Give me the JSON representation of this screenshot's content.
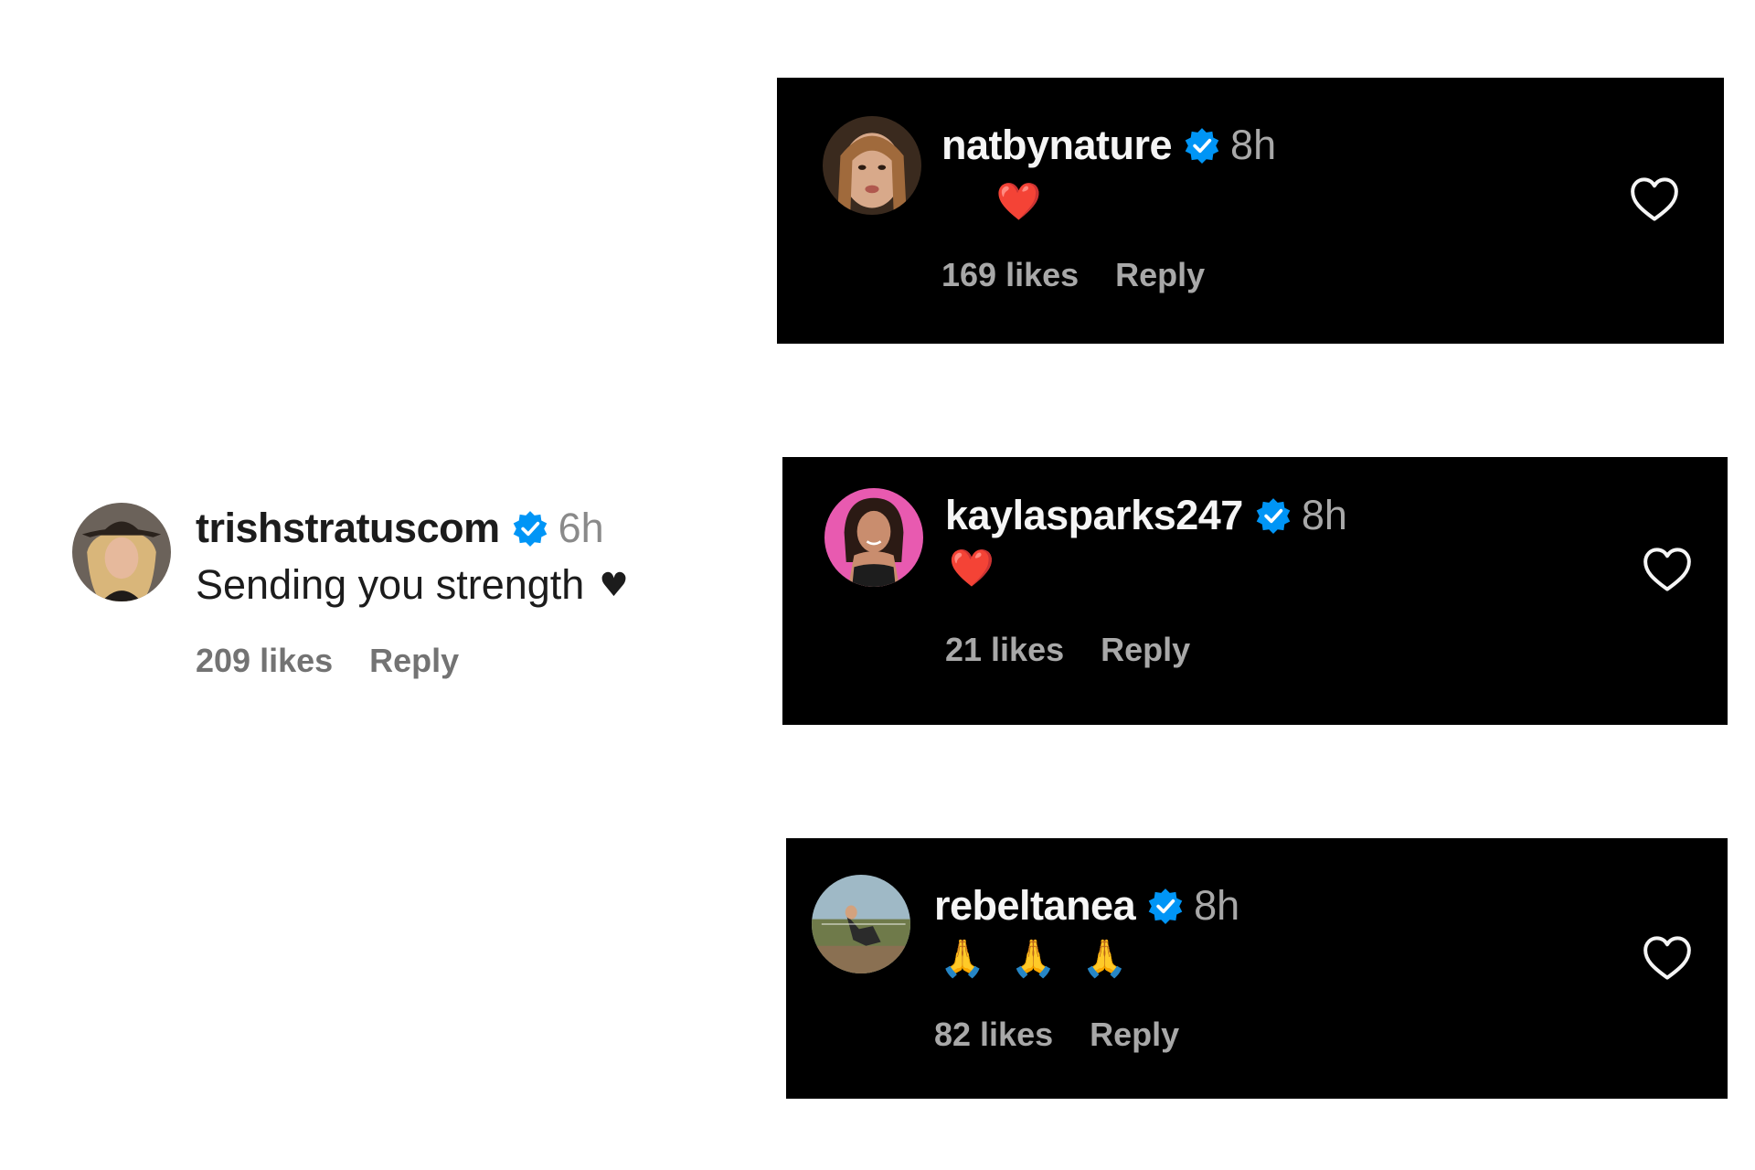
{
  "comments": [
    {
      "username": "natbynature",
      "verified": true,
      "time": "8h",
      "emoji": [
        "😞",
        "❤️"
      ],
      "likes": "169 likes",
      "reply": "Reply",
      "theme": "dark"
    },
    {
      "username": "trishstratuscom",
      "verified": true,
      "time": "6h",
      "text": "Sending you strength",
      "text_emoji": "♥",
      "likes": "209 likes",
      "reply": "Reply",
      "theme": "light"
    },
    {
      "username": "kaylasparks247",
      "verified": true,
      "time": "8h",
      "emoji": [
        "❤️",
        "😢"
      ],
      "likes": "21 likes",
      "reply": "Reply",
      "theme": "dark"
    },
    {
      "username": "rebeltanea",
      "verified": true,
      "time": "8h",
      "emoji": [
        "🙏",
        "🙏",
        "🙏"
      ],
      "likes": "82 likes",
      "reply": "Reply",
      "theme": "dark"
    }
  ],
  "colors": {
    "card_bg": "#000000",
    "verified_badge": "#0095f6",
    "heart_red": "#ff3040"
  },
  "icons": {
    "verified": "verified-badge-icon",
    "like": "heart-outline-icon"
  }
}
